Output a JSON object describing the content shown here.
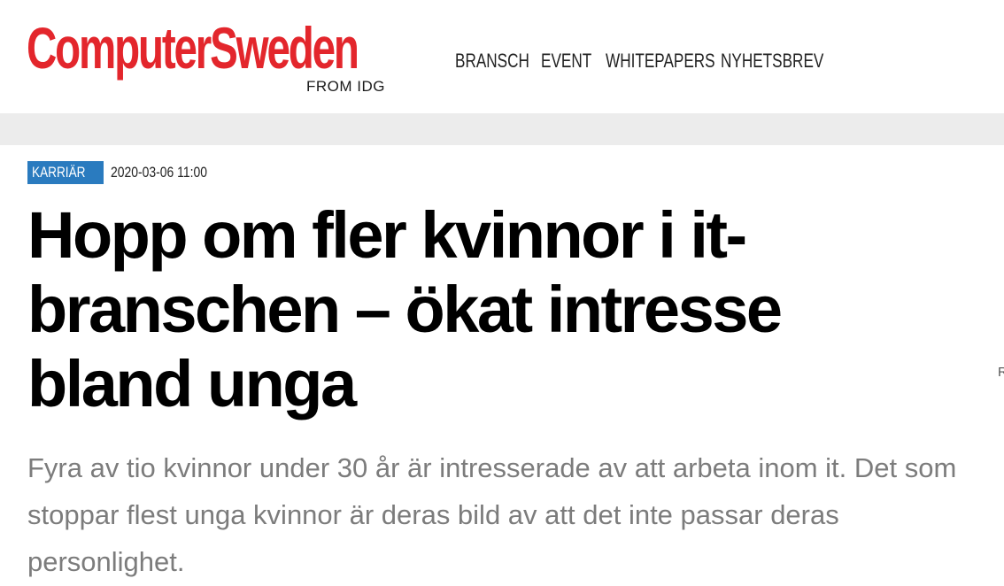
{
  "header": {
    "logo": {
      "name": "ComputerSweden",
      "tagline": "FROM IDG"
    },
    "nav": [
      {
        "label": "BRANSCH"
      },
      {
        "label": "EVENT"
      },
      {
        "label": "WHITEPAPERS"
      },
      {
        "label": "NYHETSBREV"
      }
    ]
  },
  "article": {
    "category": "KARRIÄR",
    "timestamp": "2020-03-06 11:00",
    "headline": "Hopp om fler kvinnor i it-branschen – ökat intresse bland unga",
    "lead": "Fyra av tio kvinnor under 30 år är intresserade av att arbeta inom it. Det som stoppar flest unga kvinnor är deras bild av att det inte passar deras personlighet.",
    "edge_text": "R"
  },
  "colors": {
    "brand_red": "#e3262c",
    "category_blue": "#2a7bbf",
    "lead_grey": "#7c7c7c",
    "bar_grey": "#ececec"
  }
}
